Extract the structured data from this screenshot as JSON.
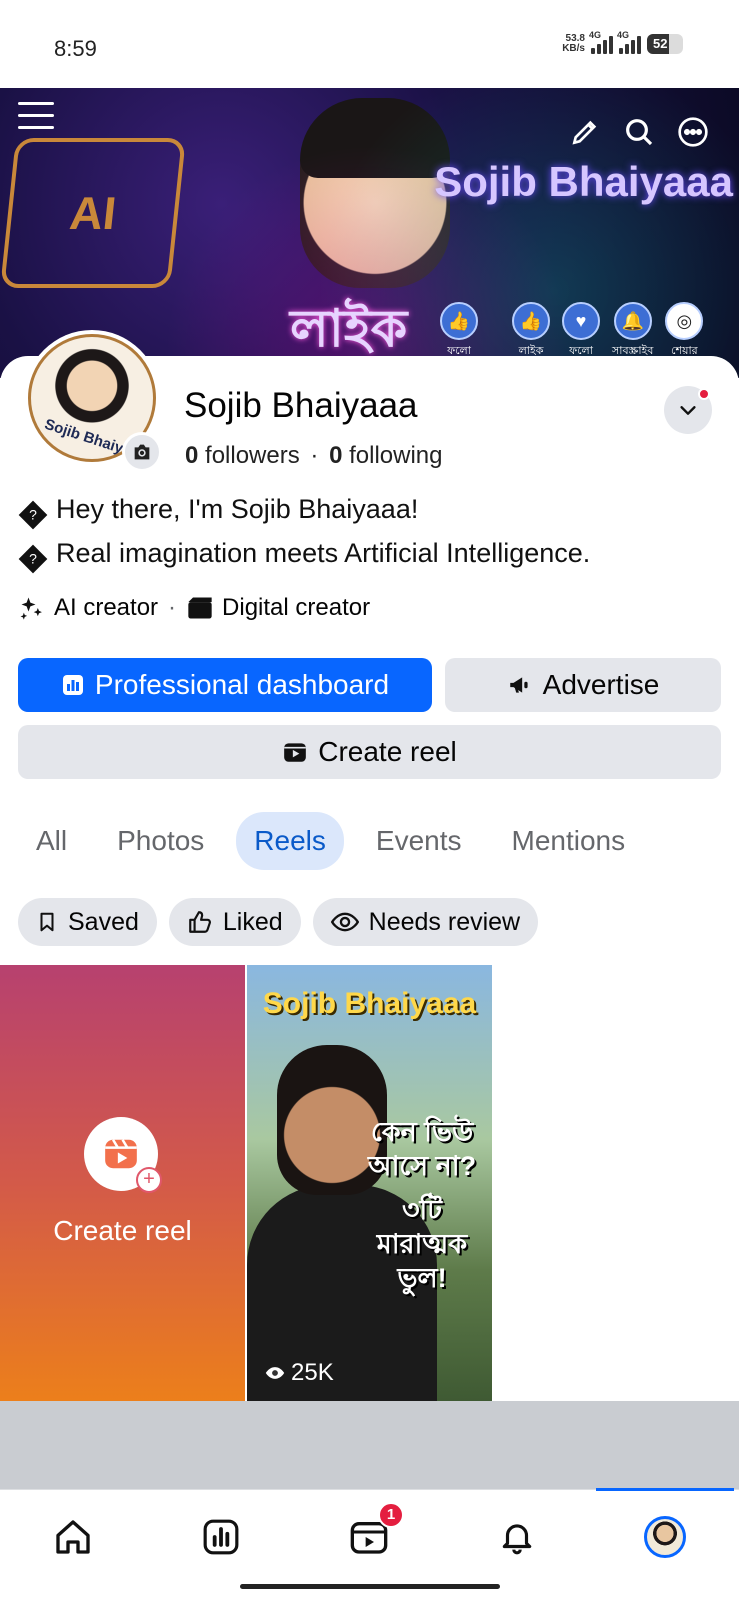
{
  "status_bar": {
    "time": "8:59",
    "net_speed_value": "53.8",
    "net_speed_unit": "KB/s",
    "network_1": "4G",
    "network_2": "4G",
    "battery": "52"
  },
  "cover": {
    "logo_text": "AI",
    "title": "Sojib Bhaiyaaa",
    "bangla_like": "লাইক",
    "actions": [
      {
        "label": "ফলো",
        "icon": "thumb-up-icon"
      },
      {
        "label": "লাইক",
        "icon": "thumb-up-icon"
      },
      {
        "label": "ফলো",
        "icon": "heart-icon"
      },
      {
        "label": "সাবস্ক্রাইব",
        "icon": "bell-icon"
      },
      {
        "label": "শেয়ার",
        "icon": "share-icon"
      }
    ]
  },
  "profile": {
    "name": "Sojib Bhaiyaaa",
    "avatar_text": "Sojib Bhaiy",
    "followers_count": "0",
    "followers_label": "followers",
    "separator": "·",
    "following_count": "0",
    "following_label": "following",
    "bio_lines": [
      "Hey there, I'm Sojib Bhaiyaaa!",
      "Real imagination meets Artificial Intelligence."
    ],
    "bio_glyph": "?",
    "categories": [
      "AI creator",
      "Digital creator"
    ]
  },
  "buttons": {
    "professional_dashboard": "Professional dashboard",
    "advertise": "Advertise",
    "create_reel": "Create reel"
  },
  "tabs": [
    "All",
    "Photos",
    "Reels",
    "Events",
    "Mentions"
  ],
  "active_tab": "Reels",
  "chips": [
    "Saved",
    "Liked",
    "Needs review"
  ],
  "reels": {
    "create_label": "Create reel",
    "video": {
      "title": "Sojib Bhaiyaaa",
      "overlay_line1": "কেন ভিউ আসে না?",
      "overlay_line2": "৩টি মারাত্মক ভুল!",
      "views": "25K"
    }
  },
  "bottom_nav": {
    "items": [
      "home-icon",
      "insights-icon",
      "reels-icon",
      "bell-icon",
      "profile-avatar"
    ],
    "reels_badge": "1",
    "accent": "#0866ff"
  },
  "colors": {
    "primary": "#0866ff",
    "secondary_button": "#e4e6eb",
    "active_tab_bg": "#dbe7fb",
    "badge_red": "#e41e3f"
  }
}
